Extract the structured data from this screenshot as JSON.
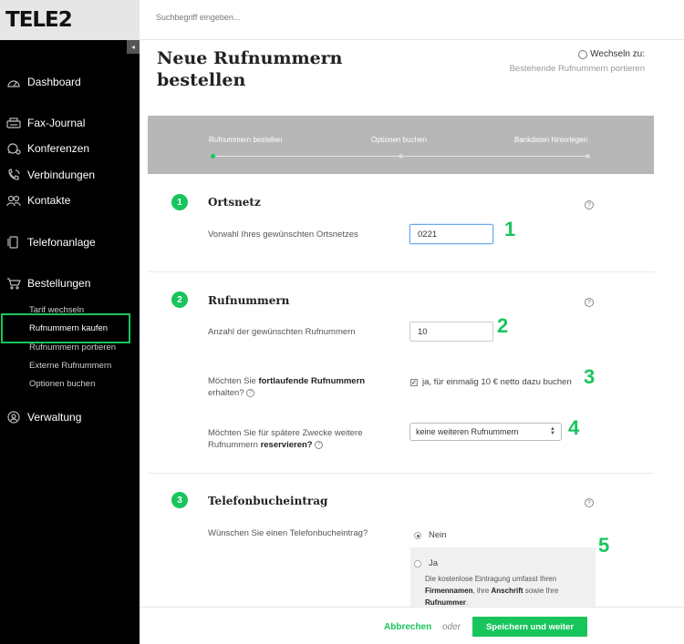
{
  "brand": {
    "logo": "TELE2"
  },
  "topbar": {
    "search_placeholder": "Suchbegriff eingeben..."
  },
  "sidebar": {
    "collapse_glyph": "◂",
    "items": [
      {
        "label": "Dashboard",
        "icon": "dashboard-icon"
      },
      {
        "label": "Fax-Journal",
        "icon": "fax-icon"
      },
      {
        "label": "Konferenzen",
        "icon": "conference-icon"
      },
      {
        "label": "Verbindungen",
        "icon": "phone-icon"
      },
      {
        "label": "Kontakte",
        "icon": "contacts-icon"
      },
      {
        "label": "Telefonanlage",
        "icon": "phone-system-icon"
      },
      {
        "label": "Bestellungen",
        "icon": "cart-icon"
      },
      {
        "label": "Verwaltung",
        "icon": "user-icon"
      }
    ],
    "sub_items": [
      {
        "label": "Tarif wechseln"
      },
      {
        "label": "Rufnummern kaufen",
        "active": true
      },
      {
        "label": "Rufnummern portieren"
      },
      {
        "label": "Externe Rufnummern"
      },
      {
        "label": "Optionen buchen"
      }
    ]
  },
  "header": {
    "title": "Neue Rufnummern bestellen",
    "switch_label": "Wechseln zu:",
    "switch_link": "Bestehende Rufnummern portieren"
  },
  "stepper": {
    "steps": [
      {
        "label": "Rufnummern bestellen",
        "active": true
      },
      {
        "label": "Optionen buchen",
        "active": false
      },
      {
        "label": "Bankdaten hinterlegen",
        "active": false
      }
    ]
  },
  "sections": [
    {
      "number": "1",
      "title": "Ortsnetz",
      "fields": [
        {
          "label": "Vorwahl Ihres gewünschten Ortsnetzes",
          "value": "0221"
        }
      ]
    },
    {
      "number": "2",
      "title": "Rufnummern",
      "fields": [
        {
          "label": "Anzahl der gewünschten Rufnummern",
          "value": "10"
        },
        {
          "label_pre": "Möchten Sie ",
          "label_bold": "fortlaufende Rufnummern",
          "label_post": " erhalten?",
          "checkbox_label": "ja, für einmalig 10 € netto dazu buchen",
          "checked": true
        },
        {
          "label_pre": "Möchten Sie für spätere Zwecke weitere Rufnummern ",
          "label_bold": "reservieren?",
          "select_value": "keine weiteren Rufnummern"
        }
      ]
    },
    {
      "number": "3",
      "title": "Telefonbucheintrag",
      "fields": [
        {
          "label": "Wünschen Sie einen Telefonbucheintrag?",
          "options": [
            {
              "label": "Nein",
              "checked": true
            },
            {
              "label": "Ja",
              "checked": false
            }
          ],
          "desc_pre": "Die kostenlose Eintragung umfasst Ihren ",
          "desc_b1": "Firmennamen",
          "desc_mid": ", ihre ",
          "desc_b2": "Anschrift",
          "desc_mid2": " sowie Ihre ",
          "desc_b3": "Rufnummer",
          "desc_end": "."
        }
      ]
    }
  ],
  "annotations": [
    "1",
    "2",
    "3",
    "4",
    "5"
  ],
  "footer": {
    "cancel_label": "Abbrechen",
    "or_label": "oder",
    "save_label": "Speichern und weiter"
  },
  "colors": {
    "accent": "#18c55c",
    "sidebar_bg": "#000000",
    "stepper_bg": "#b7b7b7"
  }
}
